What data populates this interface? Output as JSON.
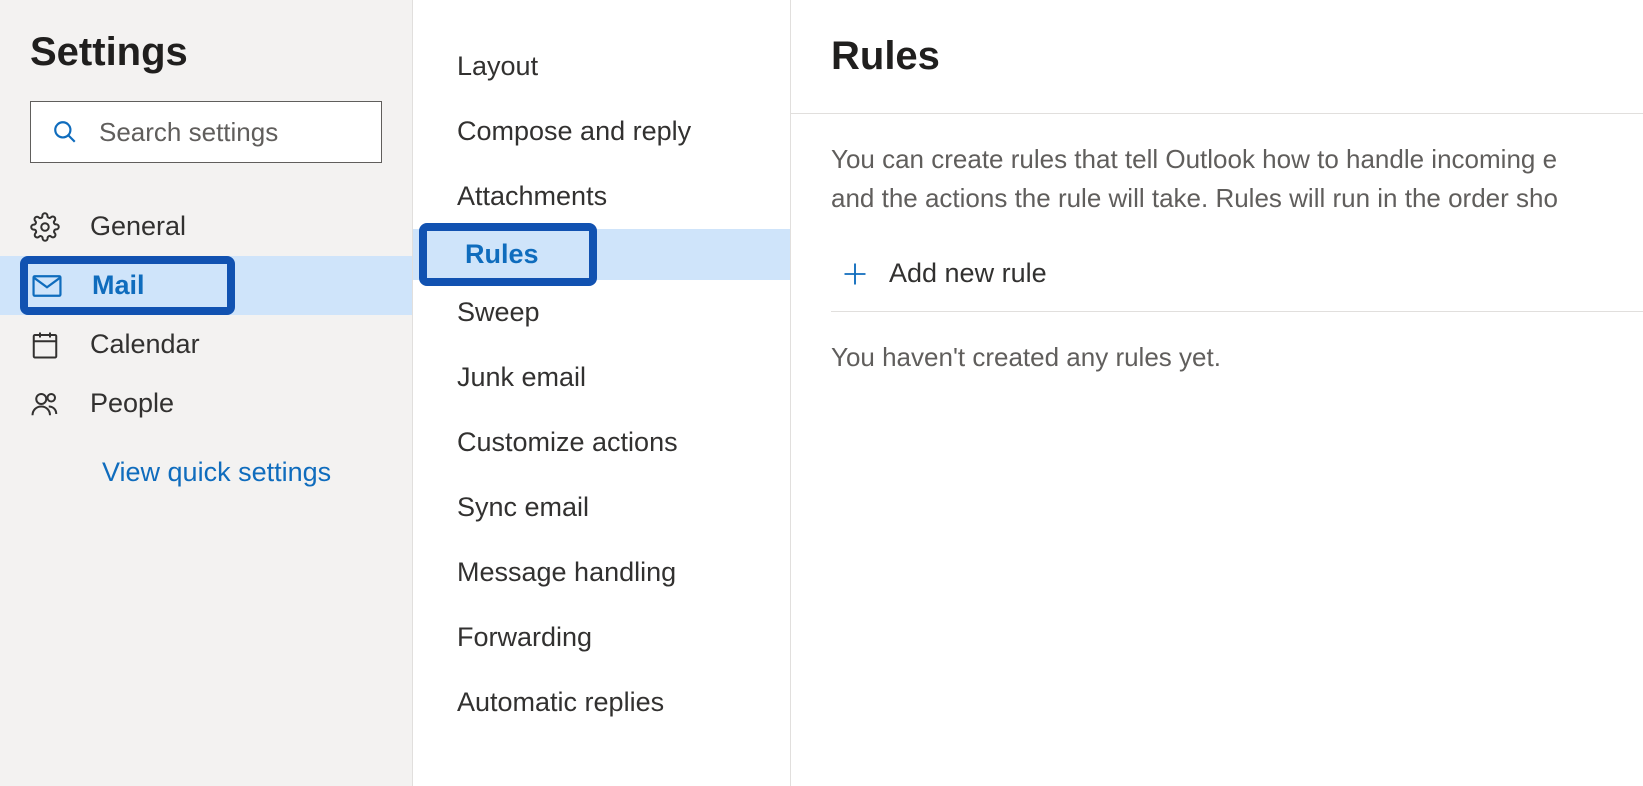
{
  "left": {
    "title": "Settings",
    "search_placeholder": "Search settings",
    "nav": {
      "general": "General",
      "mail": "Mail",
      "calendar": "Calendar",
      "people": "People"
    },
    "quick_link": "View quick settings"
  },
  "mid": {
    "items": {
      "layout": "Layout",
      "compose": "Compose and reply",
      "attachments": "Attachments",
      "rules": "Rules",
      "sweep": "Sweep",
      "junk": "Junk email",
      "customize": "Customize actions",
      "sync": "Sync email",
      "message_handling": "Message handling",
      "forwarding": "Forwarding",
      "auto_replies": "Automatic replies"
    }
  },
  "right": {
    "title": "Rules",
    "description": "You can create rules that tell Outlook how to handle incoming email messages. You can also choose actions the rule will take. Rules will run in the order shown below.",
    "desc_line1": "You can create rules that tell Outlook how to handle incoming e",
    "desc_line2": "and the actions the rule will take. Rules will run in the order sho",
    "add_rule": "Add new rule",
    "empty": "You haven't created any rules yet."
  }
}
